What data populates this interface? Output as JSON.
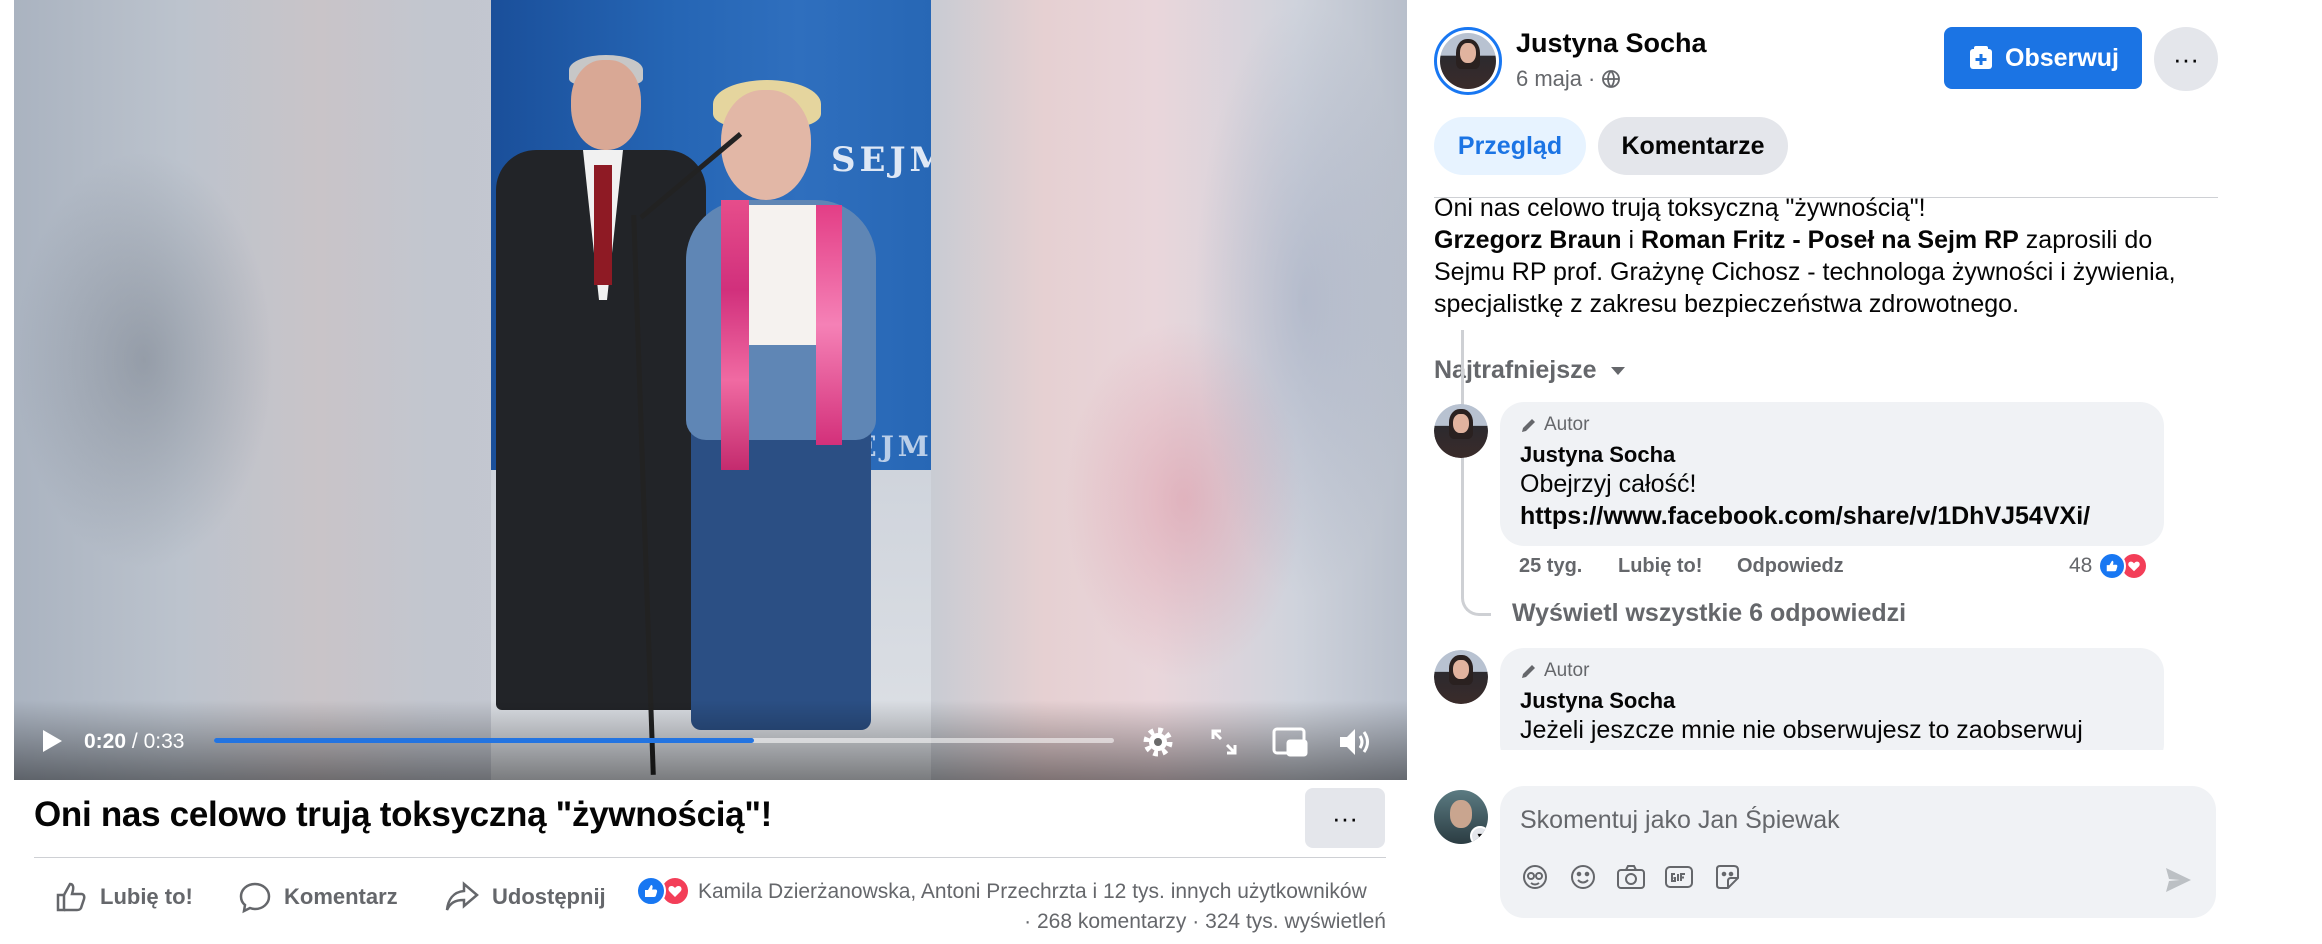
{
  "video": {
    "current_time": "0:20",
    "duration": "0:33",
    "separator": "/",
    "progress_fraction": 0.6,
    "frame_logo_text": "SEJM"
  },
  "post": {
    "title": "Oni nas celowo trują toksyczną \"żywnością\"!",
    "more_label": "···",
    "actions": {
      "like_label": "Lubię to!",
      "comment_label": "Komentarz",
      "share_label": "Udostępnij"
    },
    "reactors_text": "Kamila Dzierżanowska, Antoni Przechrzta i 12 tys. innych użytkowników",
    "comments_count": "268 komentarzy",
    "views_count": "324 tys. wyświetleń",
    "stats_separator": "·"
  },
  "author": {
    "name": "Justyna Socha",
    "date": "6 maja",
    "date_separator": "·",
    "follow_label": "Obserwuj",
    "more_label": "···"
  },
  "tabs": [
    {
      "label": "Przegląd",
      "active": true
    },
    {
      "label": "Komentarze",
      "active": false
    }
  ],
  "description": {
    "line1": "Oni nas celowo trują toksyczną \"żywnością\"!",
    "person1": "Grzegorz Braun",
    "connector": " i ",
    "person2": "Roman Fritz - Poseł na Sejm RP",
    "rest": " zaprosili do Sejmu RP prof. Grażynę Cichosz - technologa żywności i żywienia, specjalistkę z zakresu bezpieczeństwa zdrowotnego."
  },
  "comments_sort": "Najtrafniejsze",
  "comments": [
    {
      "badge": "Autor",
      "author": "Justyna Socha",
      "text": "Obejrzyj całość!",
      "link": "https://www.facebook.com/share/v/1DhVJ54VXi/",
      "time": "25 tyg.",
      "like_label": "Lubię to!",
      "reply_label": "Odpowiedz",
      "reaction_count": "48"
    },
    {
      "badge": "Autor",
      "author": "Justyna Socha",
      "text": "Jeżeli jeszcze mnie nie obserwujesz to zaobserwuj"
    }
  ],
  "show_replies": "Wyświetl wszystkie 6 odpowiedzi",
  "composer": {
    "placeholder": "Skomentuj jako Jan Śpiewak"
  },
  "colors": {
    "brand_blue": "#1b74e4",
    "text_secondary": "#65676b",
    "bubble_bg": "#f0f2f5",
    "like_blue": "#1877f2",
    "love_red": "#f33e58"
  }
}
